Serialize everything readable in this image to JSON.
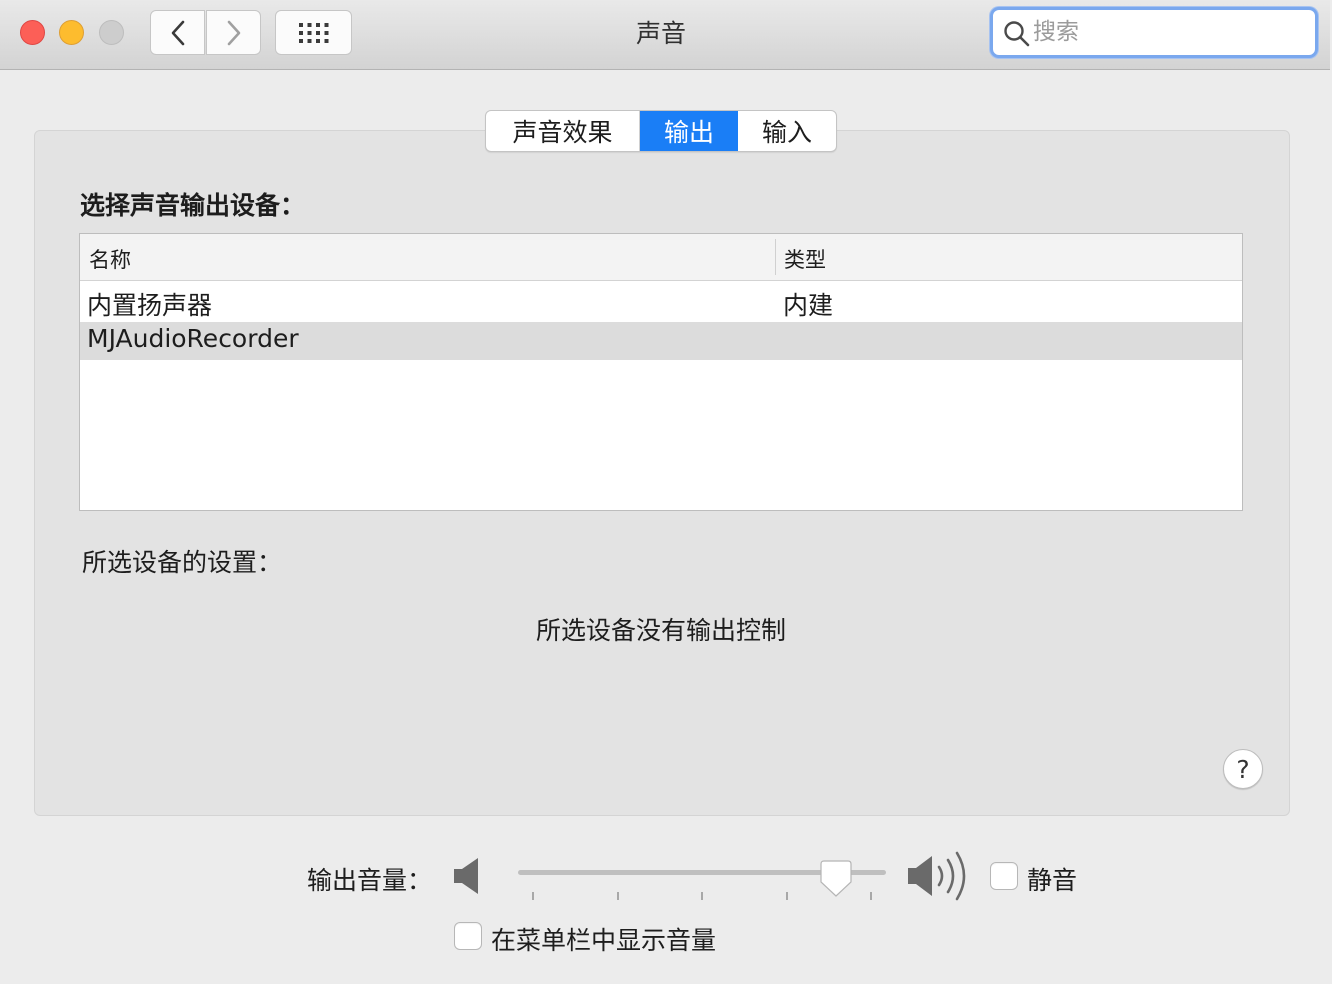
{
  "window": {
    "title": "声音"
  },
  "toolbar": {
    "back_icon": "chevron-left-icon",
    "forward_icon": "chevron-right-icon",
    "show_all_icon": "grid-icon"
  },
  "search": {
    "placeholder": "搜索",
    "value": ""
  },
  "tabs": [
    {
      "label": "声音效果",
      "selected": false
    },
    {
      "label": "输出",
      "selected": true
    },
    {
      "label": "输入",
      "selected": false
    }
  ],
  "output": {
    "heading": "选择声音输出设备：",
    "columns": [
      "名称",
      "类型"
    ],
    "devices": [
      {
        "name": "内置扬声器",
        "type": "内建",
        "selected": false
      },
      {
        "name": "MJAudioRecorder",
        "type": "",
        "selected": true
      }
    ],
    "settings_label": "所选设备的设置：",
    "no_control_text": "所选设备没有输出控制"
  },
  "help": {
    "label": "?"
  },
  "volume": {
    "label": "输出音量：",
    "level": 0.9,
    "mute_label": "静音",
    "muted": false,
    "show_in_menubar_label": "在菜单栏中显示音量",
    "show_in_menubar": false
  },
  "colors": {
    "accent": "#1a7ef6",
    "close": "#fc5f57",
    "minimize": "#fdbc2e",
    "selected_row": "#dcdcdc"
  }
}
